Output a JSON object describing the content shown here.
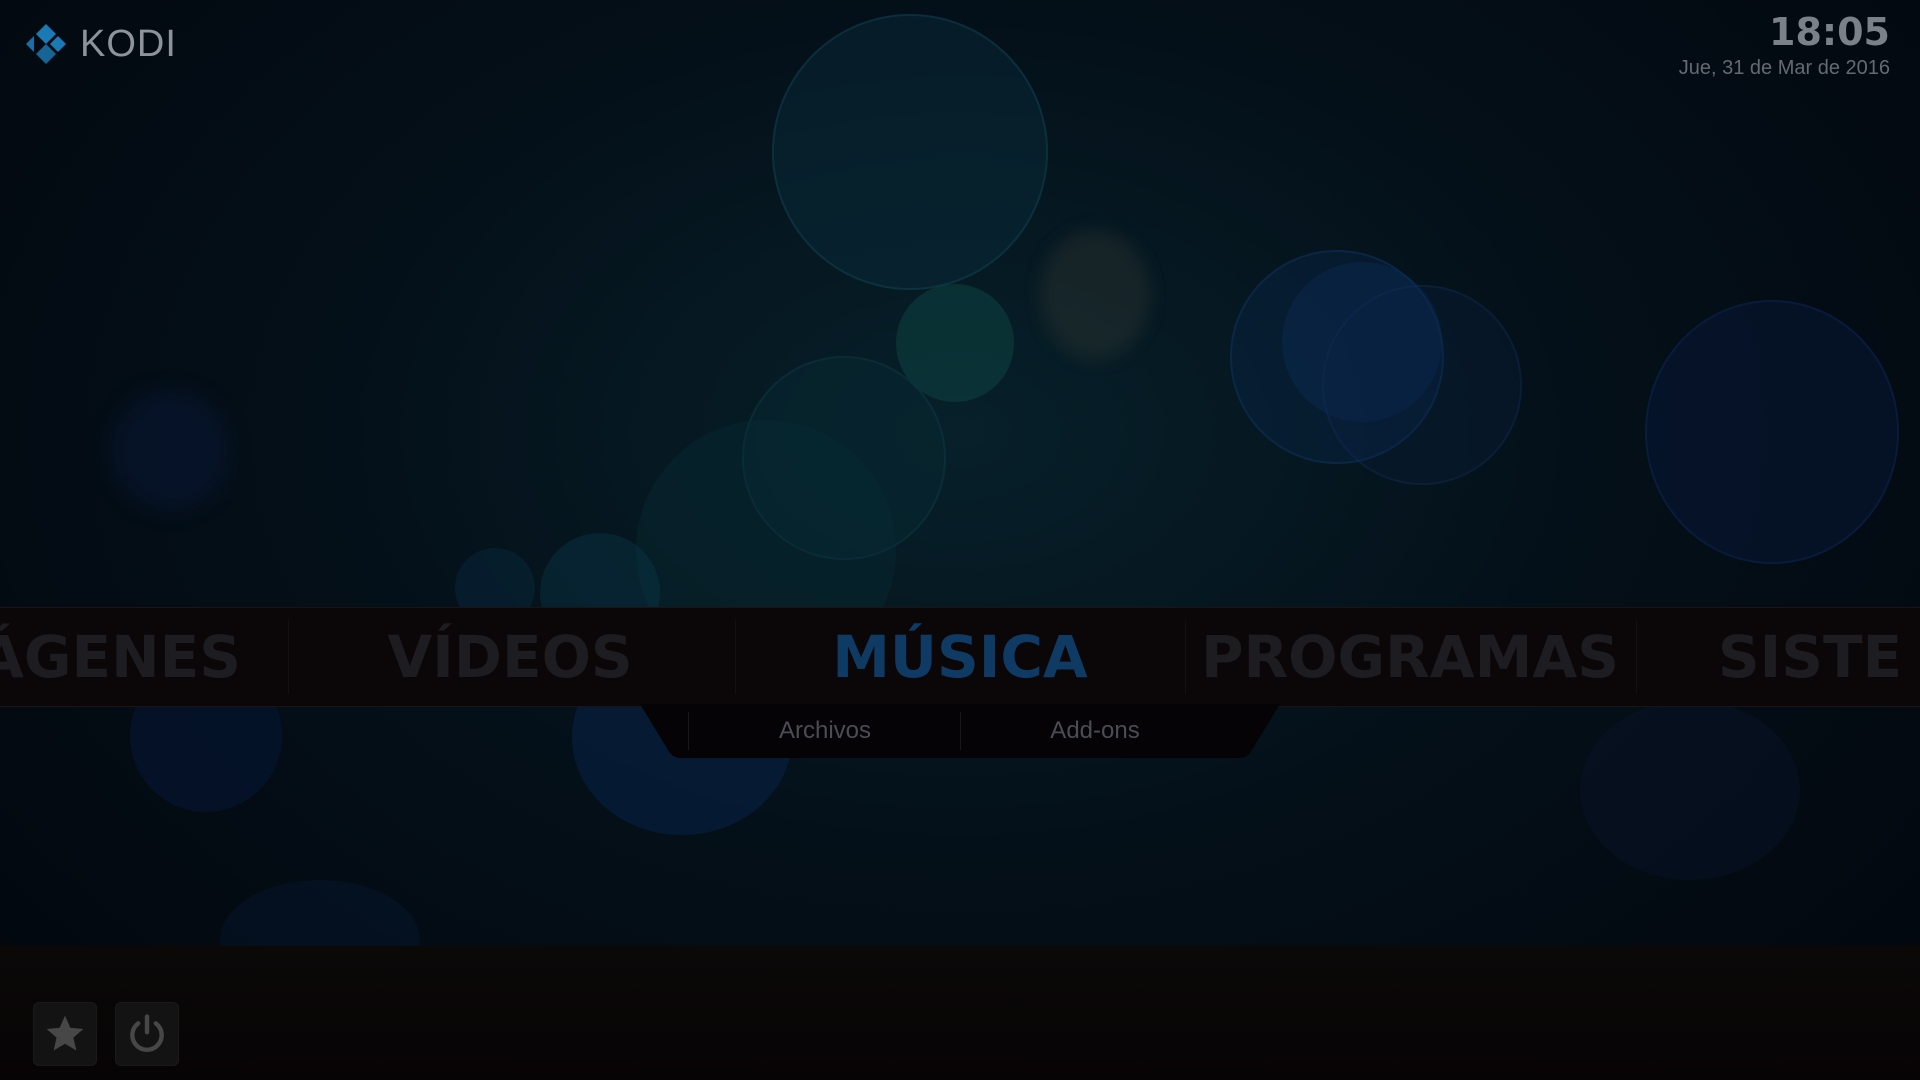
{
  "header": {
    "logo_text": "KODI",
    "time": "18:05",
    "date": "Jue, 31 de Mar de 2016"
  },
  "main_menu": {
    "items": [
      {
        "label": "ÁGENES",
        "active": false
      },
      {
        "label": "VÍDEOS",
        "active": false
      },
      {
        "label": "MÚSICA",
        "active": true
      },
      {
        "label": "PROGRAMAS",
        "active": false
      },
      {
        "label": "SISTE",
        "active": false
      }
    ]
  },
  "submenu": {
    "items": [
      {
        "label": "Archivos"
      },
      {
        "label": "Add-ons"
      }
    ]
  },
  "bottom_bar": {
    "buttons": [
      {
        "icon": "star-icon"
      },
      {
        "icon": "power-icon"
      }
    ]
  },
  "colors": {
    "active_menu": "#0f3a63",
    "inactive_menu": "#1d1c20",
    "kodi_blue": "#1b7ab3"
  }
}
